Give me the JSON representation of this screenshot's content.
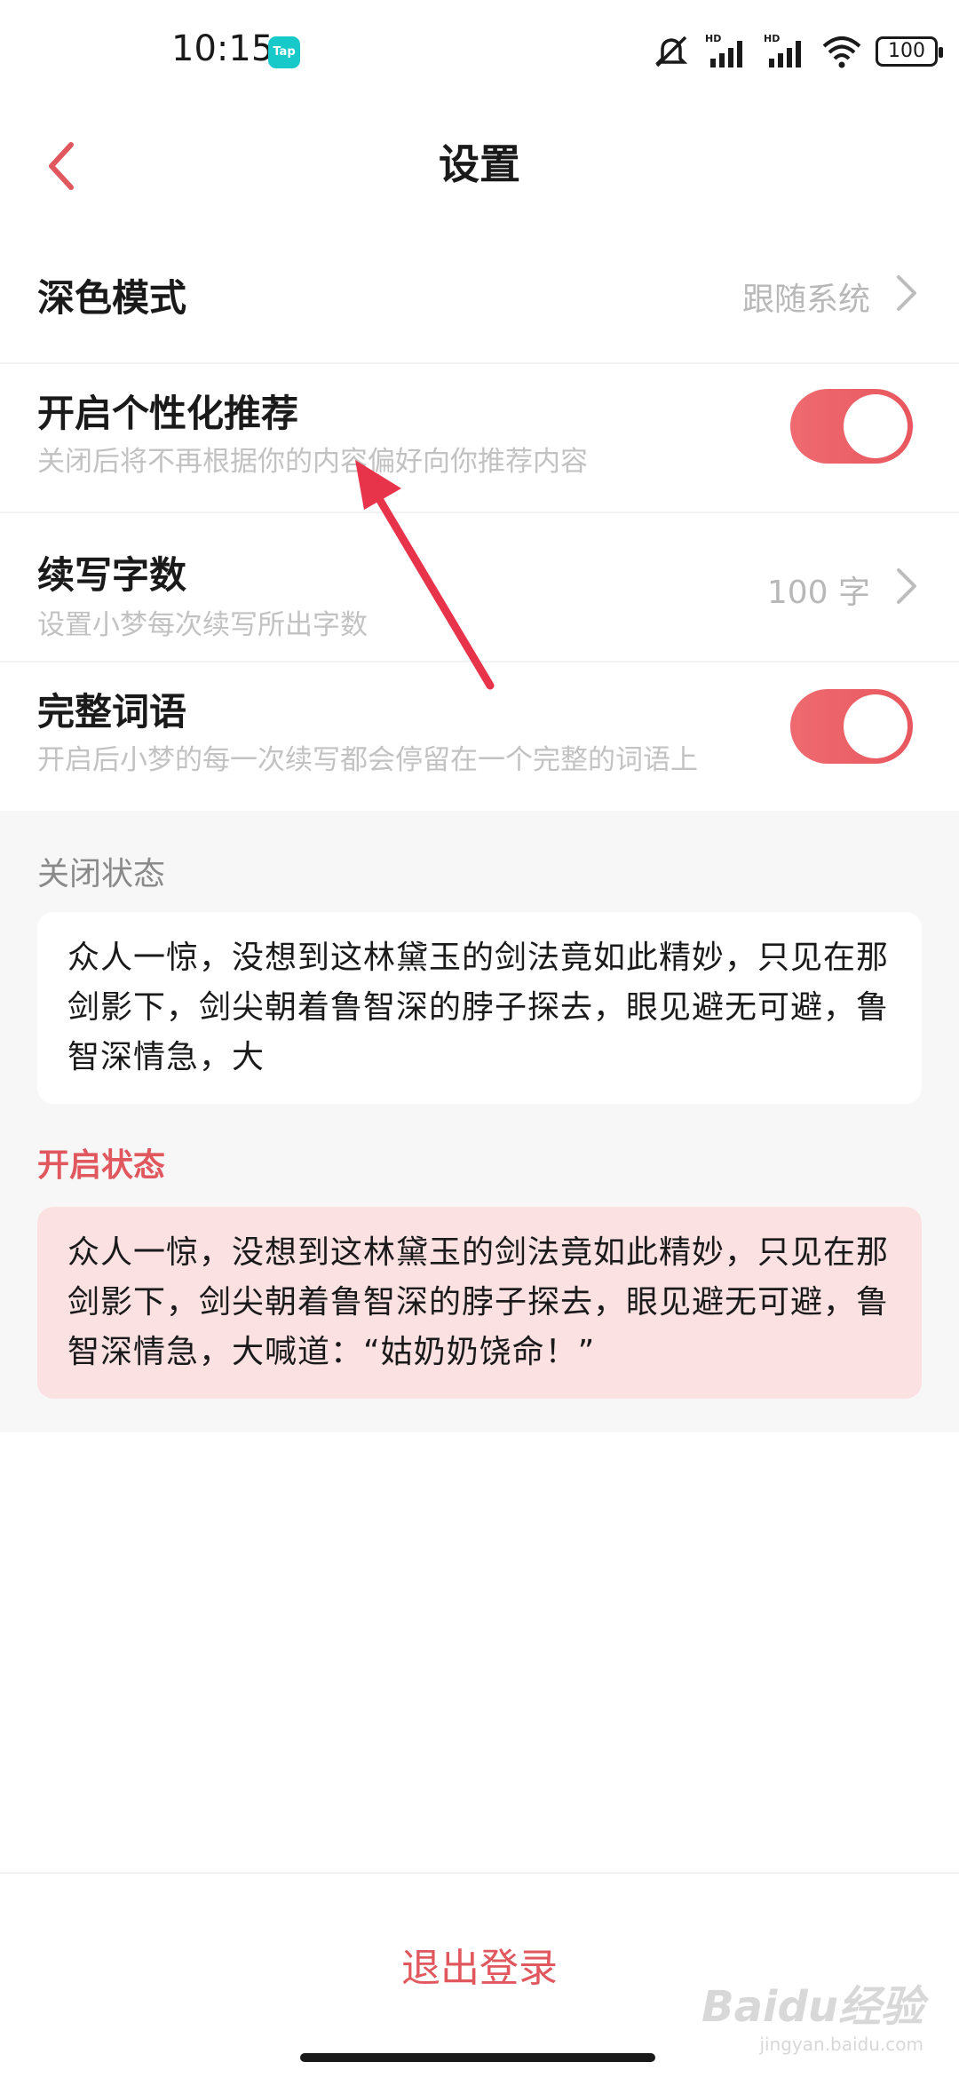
{
  "status_bar": {
    "time": "10:15",
    "app_badge": "Tap",
    "battery": "100",
    "icons": [
      "mute-icon",
      "hd-signal-icon",
      "hd-signal-icon",
      "wifi-icon",
      "battery-icon"
    ]
  },
  "header": {
    "title": "设置",
    "back_icon": "chevron-left-icon"
  },
  "settings": {
    "dark_mode": {
      "title": "深色模式",
      "value": "跟随系统"
    },
    "personalized": {
      "title": "开启个性化推荐",
      "subtitle": "关闭后将不再根据你的内容偏好向你推荐内容",
      "enabled": true
    },
    "word_count": {
      "title": "续写字数",
      "subtitle": "设置小梦每次续写所出字数",
      "value": "100 字"
    },
    "complete_words": {
      "title": "完整词语",
      "subtitle": "开启后小梦的每一次续写都会停留在一个完整的词语上",
      "enabled": true
    }
  },
  "preview": {
    "off_label": "关闭状态",
    "off_text": "众人一惊，没想到这林黛玉的剑法竟如此精妙，只见在那剑影下，剑尖朝着鲁智深的脖子探去，眼见避无可避，鲁智深情急，大",
    "on_label": "开启状态",
    "on_text": "众人一惊，没想到这林黛玉的剑法竟如此精妙，只见在那剑影下，剑尖朝着鲁智深的脖子探去，眼见避无可避，鲁智深情急，大喊道：“姑奶奶饶命！”"
  },
  "logout": {
    "label": "退出登录"
  },
  "watermark": {
    "logo": "Baidu经验",
    "url": "jingyan.baidu.com"
  },
  "colors": {
    "accent": "#e0575e",
    "toggle_on": "#e8575e",
    "highlight_card": "#fbe1e2",
    "section_bg": "#f7f7f7",
    "annotation_arrow": "#e8344a"
  }
}
